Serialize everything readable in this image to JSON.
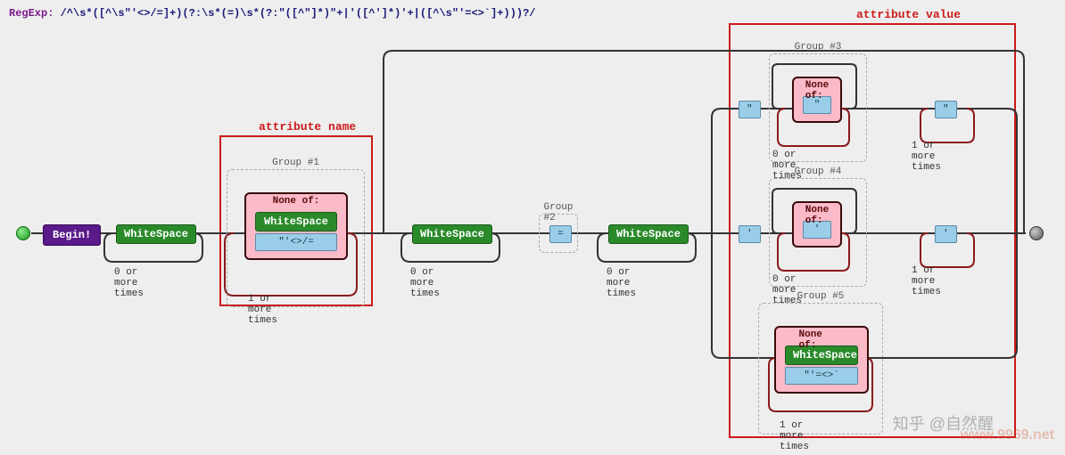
{
  "regexp_prefix": "RegExp: ",
  "regexp_raw": "/^\\s*([^\\s\"'<>/=]+)(?:\\s*(=)\\s*(?:\"([^\"]*)\"+|'([^']*)'+|([^\\s\"'=<>`]+)))?/",
  "highlights": {
    "attr_name": "attribute name",
    "attr_value": "attribute value"
  },
  "begin": "Begin!",
  "whitespace": "WhiteSpace",
  "none_of": "None of:",
  "equals": "=",
  "dq": "\"",
  "sq": "'",
  "none1_chars": "\"'<>/=",
  "none3_body": "\"",
  "none4_body": "'",
  "none5_chars": "\"'=<>`",
  "group1": "Group #1",
  "group2": "Group #2",
  "group3": "Group #3",
  "group4": "Group #4",
  "group5": "Group #5",
  "t0more": "0 or more times",
  "t1more": "1 or more times",
  "watermark_cn": "知乎 @自然醒",
  "watermark_url": "www.9969.net"
}
